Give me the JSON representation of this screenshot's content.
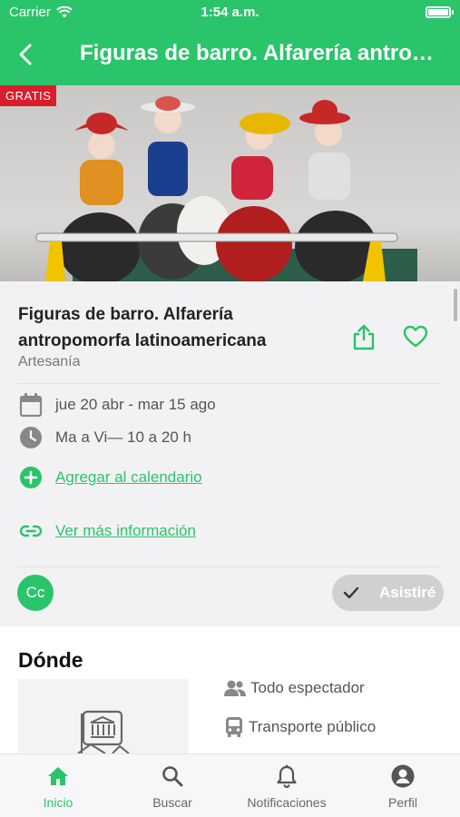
{
  "status_bar": {
    "carrier": "Carrier",
    "time": "1:54 a.m."
  },
  "nav": {
    "title": "Figuras de barro. Alfarería antropomorfa latinoamericana"
  },
  "hero": {
    "badge": "GRATIS"
  },
  "event": {
    "title": "Figuras de barro. Alfarería antropomorfa latinoamericana",
    "category": "Artesanía",
    "dates": "jue 20 abr - mar 15 ago",
    "hours": "Ma a Vi— 10 a 20 h",
    "add_calendar": "Agregar al calendario",
    "more_info": "Ver más información",
    "avatar_initials": "Cc",
    "attend_label": "Asistiré"
  },
  "where": {
    "heading": "Dónde",
    "audience": "Todo espectador",
    "transport": "Transporte público"
  },
  "tabs": [
    {
      "label": "Inicio",
      "icon": "home-icon",
      "active": true
    },
    {
      "label": "Buscar",
      "icon": "search-icon",
      "active": false
    },
    {
      "label": "Notificaciones",
      "icon": "bell-icon",
      "active": false
    },
    {
      "label": "Perfil",
      "icon": "user-icon",
      "active": false
    }
  ],
  "colors": {
    "accent": "#2ac46a",
    "badge": "#d81d2c",
    "muted": "#777777"
  }
}
